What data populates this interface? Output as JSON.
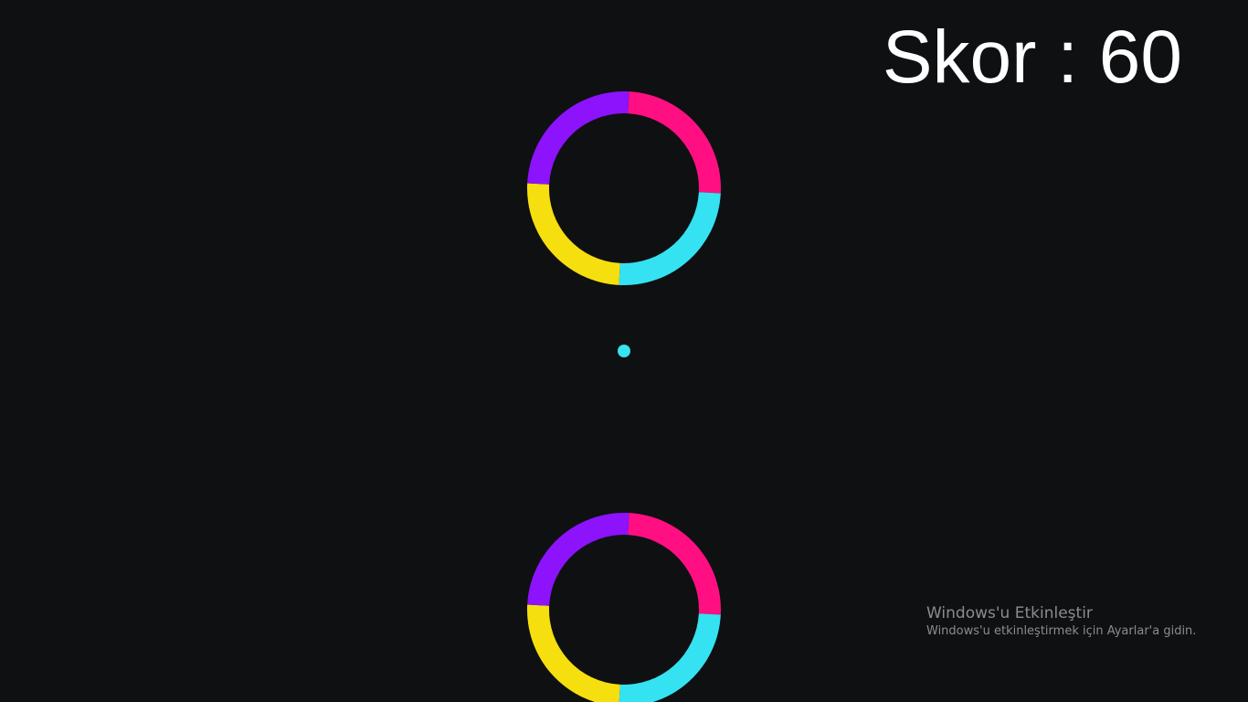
{
  "score": {
    "label": "Skor",
    "separator": " : ",
    "value": 60,
    "text": "Skor : 60"
  },
  "colors": {
    "background": "#0f1012",
    "magenta": "#ff0f82",
    "cyan": "#35e2f2",
    "yellow": "#f6df0e",
    "purple": "#8c13fb",
    "ball": "#35e2f2"
  },
  "obstacles": [
    {
      "type": "ring",
      "segments": [
        "magenta",
        "cyan",
        "yellow",
        "purple"
      ]
    },
    {
      "type": "ring",
      "segments": [
        "magenta",
        "cyan",
        "yellow",
        "purple"
      ]
    }
  ],
  "player": {
    "color": "cyan"
  },
  "watermark": {
    "title": "Windows'u Etkinleştir",
    "subtitle": "Windows'u etkinleştirmek için Ayarlar'a gidin."
  }
}
